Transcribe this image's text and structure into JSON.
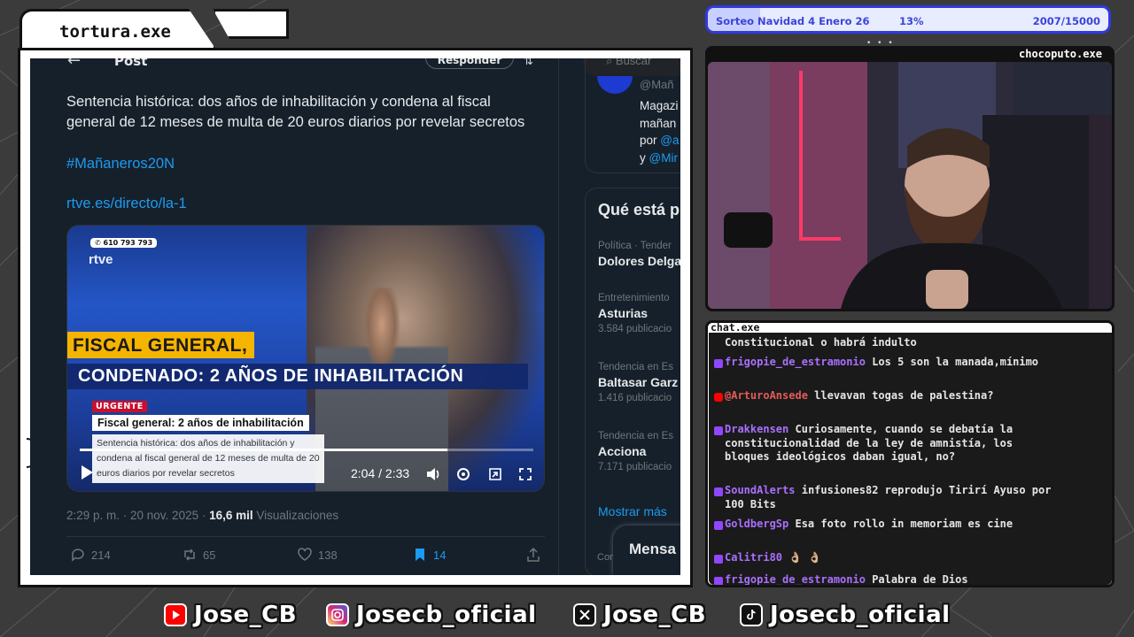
{
  "window": {
    "title": "tortura.exe"
  },
  "tweet": {
    "back_icon": "arrow-left-icon",
    "header": "Post",
    "reply_button": "Responder",
    "text": "Sentencia histórica: dos años de inhabilitación y condena al fiscal general de 12 meses de multa de 20 euros diarios por revelar secretos",
    "hashtag": "#Mañaneros20N",
    "link": "rtve.es/directo/la-1",
    "video": {
      "phone": "610 793 793",
      "channel": "rtve",
      "headline1": "FISCAL GENERAL,",
      "headline2": "CONDENADO: 2 AÑOS DE INHABILITACIÓN",
      "urgent": "URGENTE",
      "lower_title": "Fiscal general: 2 años de inhabilitación",
      "lower_text": "Sentencia histórica: dos años de inhabilitación y condena al fiscal general de 12 meses de multa de 20 euros diarios por revelar secretos",
      "time": "2:04 / 2:33",
      "progress": 0.81
    },
    "meta_time": "2:29 p. m. · 20 nov. 2025 · ",
    "views_count": "16,6 mil",
    "views_label": " Visualizaciones",
    "actions": {
      "replies": "214",
      "reposts": "65",
      "likes": "138",
      "bookmarks": "14"
    }
  },
  "sidebar": {
    "search_placeholder": "Buscar",
    "profile": {
      "handle": "@Mañ",
      "bio_line1": "Magazi",
      "bio_line2": "mañan",
      "bio_line3_pre": "por ",
      "bio_line3_mention": "@a",
      "bio_line4_pre": "y ",
      "bio_line4_mention": "@Mir"
    },
    "trends_title": "Qué está p",
    "trends": [
      {
        "category": "Política · Tender",
        "name": "Dolores Delga",
        "count": ""
      },
      {
        "category": "Entretenimiento",
        "name": "Asturias",
        "count": "3.584 publicacio"
      },
      {
        "category": "Tendencia en Es",
        "name": "Baltasar Garz",
        "count": "1.416 publicacio"
      },
      {
        "category": "Tendencia en Es",
        "name": "Acciona",
        "count": "7.171 publicacio"
      }
    ],
    "show_more": "Mostrar más",
    "messages": "Mensa",
    "footer": "Con"
  },
  "goal": {
    "title": "Sorteo Navidad 4 Enero 26",
    "percent": "13%",
    "count": "2007/15000",
    "fraction": 0.13
  },
  "webcam": {
    "label": "chocoputo.exe"
  },
  "chat": {
    "title": "chat.exe",
    "messages": [
      {
        "platform": "",
        "user": "",
        "text": "Constitucional o habrá indulto"
      },
      {
        "platform": "twitch",
        "user": "frigopie_de_estramonio",
        "text": "Los 5 son la manada,mínimo"
      },
      {
        "platform": "youtube",
        "user": "@ArturoAnsede",
        "text": "llevavan togas de palestina?"
      },
      {
        "platform": "twitch",
        "user": "Drakkensen",
        "text": "Curiosamente, cuando se debatía la constitucionalidad de la ley de amnistía, los bloques ideológicos daban igual, no?"
      },
      {
        "platform": "twitch",
        "user": "SoundAlerts",
        "text": "infusiones82 reprodujo Tirirí Ayuso por 100 Bits"
      },
      {
        "platform": "twitch",
        "user": "GoldbergSp",
        "text": "Esa foto rollo in memoriam es cine"
      },
      {
        "platform": "twitch",
        "user": "Calitri80",
        "text": "👌🏼 👌🏼"
      },
      {
        "platform": "twitch",
        "user": "frigopie_de_estramonio",
        "text": "Palabra de Dios"
      }
    ]
  },
  "socials": [
    {
      "icon": "youtube-icon",
      "handle": "Jose_CB",
      "color": "#ff0000"
    },
    {
      "icon": "instagram-icon",
      "handle": "Josecb_oficial",
      "color": "#d62976"
    },
    {
      "icon": "x-icon",
      "handle": "Jose_CB",
      "color": "#111111"
    },
    {
      "icon": "tiktok-icon",
      "handle": "Josecb_oficial",
      "color": "#111111"
    }
  ]
}
